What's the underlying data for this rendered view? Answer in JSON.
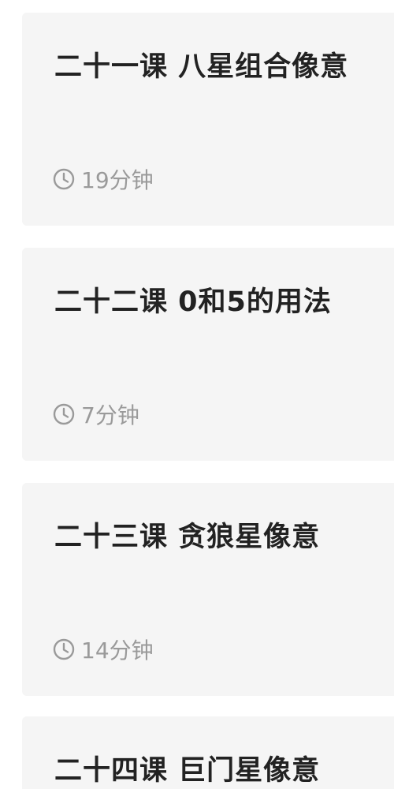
{
  "lessons": [
    {
      "title": "二十一课 八星组合像意",
      "duration": "19分钟",
      "icon": "clock-icon"
    },
    {
      "title": "二十二课 0和5的用法",
      "duration": "7分钟",
      "icon": "clock-icon"
    },
    {
      "title": "二十三课 贪狼星像意",
      "duration": "14分钟",
      "icon": "clock-icon"
    },
    {
      "title": "二十四课 巨门星像意"
    }
  ],
  "colors": {
    "card_bg": "#f5f5f5",
    "title": "#222222",
    "meta": "#9a9a9a"
  }
}
